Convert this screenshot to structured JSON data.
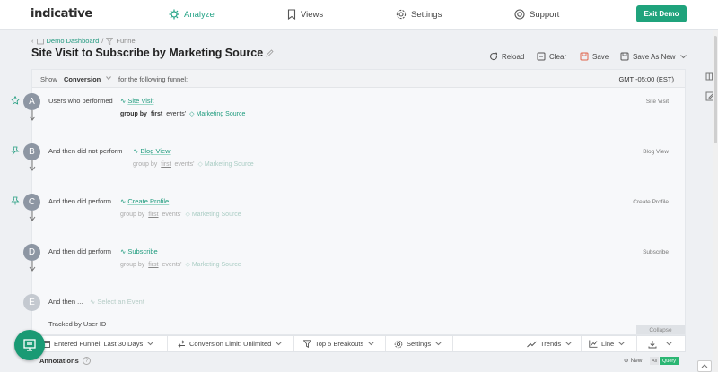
{
  "app": {
    "logo": "indicative"
  },
  "nav": {
    "analyze": "Analyze",
    "views": "Views",
    "settings": "Settings",
    "support": "Support",
    "exit_demo": "Exit Demo"
  },
  "breadcrumb": {
    "dashboard": "Demo Dashboard",
    "separator": "/",
    "current": "Funnel"
  },
  "page": {
    "title": "Site Visit to Subscribe by Marketing Source"
  },
  "toolbar": {
    "reload": "Reload",
    "clear": "Clear",
    "save": "Save",
    "save_as_new": "Save As New"
  },
  "showbar": {
    "show": "Show",
    "conversion": "Conversion",
    "following": "for the following funnel:",
    "timezone": "GMT -05:00 (EST)"
  },
  "steps": [
    {
      "letter": "A",
      "text": "Users who performed",
      "event": "Site Visit",
      "group_by": "group by",
      "first": "first",
      "events": "events'",
      "property": "Marketing Source",
      "right": "Site Visit"
    },
    {
      "letter": "B",
      "text": "And then did not perform",
      "event": "Blog View",
      "group_by": "group by",
      "first": "first",
      "events": "events'",
      "property": "Marketing Source",
      "right": "Blog View"
    },
    {
      "letter": "C",
      "text": "And then did perform",
      "event": "Create Profile",
      "group_by": "group by",
      "first": "first",
      "events": "events'",
      "property": "Marketing Source",
      "right": "Create Profile"
    },
    {
      "letter": "D",
      "text": "And then did perform",
      "event": "Subscribe",
      "group_by": "group by",
      "first": "first",
      "events": "events'",
      "property": "Marketing Source",
      "right": "Subscribe"
    },
    {
      "letter": "E",
      "text": "And then ...",
      "placeholder": "Select an Event"
    }
  ],
  "tracked": "Tracked by User ID",
  "collapse": "Collapse",
  "bottombar": {
    "entered_funnel": "Entered Funnel: Last 30 Days",
    "conversion_limit": "Conversion Limit: Unlimited",
    "breakouts": "Top 5 Breakouts",
    "settings": "Settings",
    "trends": "Trends",
    "line": "Line"
  },
  "annotations": {
    "label": "Annotations",
    "help": "?",
    "new": "New",
    "all": "All",
    "query": "Query"
  },
  "colors": {
    "brand": "#1fa37c",
    "step_active": "#8d96a3",
    "step_inactive": "#c4c9d0"
  }
}
